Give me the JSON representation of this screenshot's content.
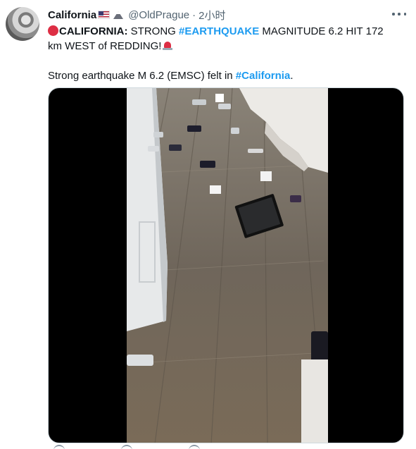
{
  "tweet": {
    "author": {
      "name": "California",
      "handle": "@OldPrague",
      "separator": "·",
      "time": "2小时"
    },
    "text": {
      "caps_label": "CALIFORNIA:",
      "part1": " STRONG ",
      "hashtag_quake": "#EARTHQUAKE",
      "part2": " MAGNITUDE 6.2 HIT 172 km WEST of REDDING!",
      "line2_text": "Strong earthquake M 6.2 (EMSC)  felt in ",
      "hashtag_california": "#California",
      "line2_end": "."
    },
    "icons": {
      "flag": "us-flag-icon",
      "mountain": "snow-mountain-icon",
      "red_circle": "red-circle-icon",
      "siren": "siren-icon",
      "more": "more-icon"
    },
    "colors": {
      "link": "#1d9bf0",
      "secondary_text": "#536471",
      "primary_text": "#0f1419",
      "media_letterbox": "#000000"
    }
  }
}
